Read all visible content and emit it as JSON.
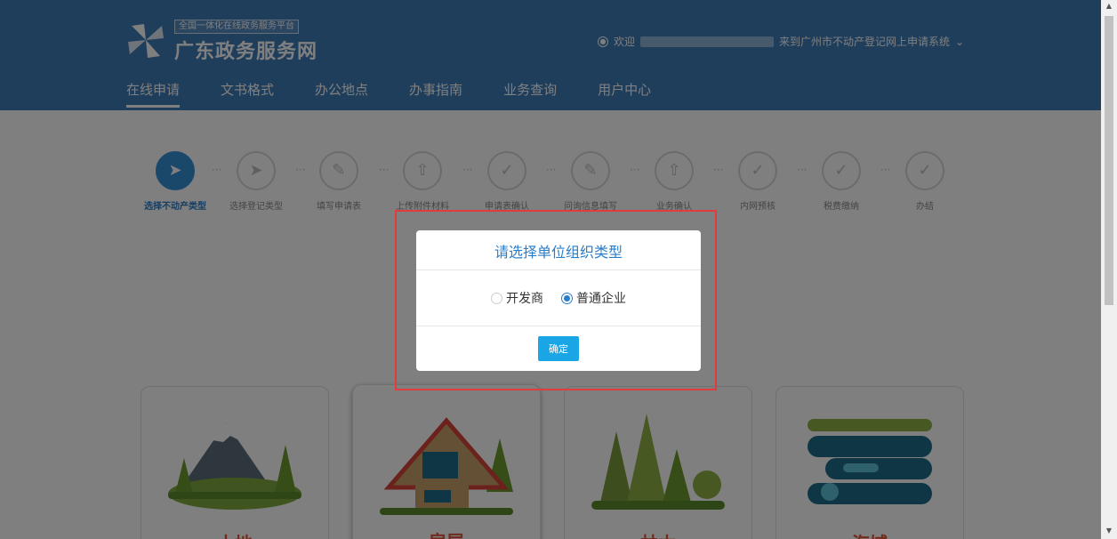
{
  "header": {
    "platform_tag": "全国一体化在线政务服务平台",
    "site_name": "广东政务服务网",
    "welcome_prefix": "欢迎",
    "welcome_suffix": "来到广州市不动产登记网上申请系统",
    "user_icon": "user-icon",
    "dropdown_icon": "chevron-down-icon"
  },
  "nav": [
    "在线申请",
    "文书格式",
    "办公地点",
    "办事指南",
    "业务查询",
    "用户中心"
  ],
  "steps": [
    {
      "label": "选择不动产类型",
      "icon": "cursor-icon",
      "active": true
    },
    {
      "label": "选择登记类型",
      "icon": "cursor-icon"
    },
    {
      "label": "填写申请表",
      "icon": "pencil-icon"
    },
    {
      "label": "上传附件材料",
      "icon": "upload-icon"
    },
    {
      "label": "申请表确认",
      "icon": "edit-check-icon"
    },
    {
      "label": "问询信息填写",
      "icon": "pencil-icon"
    },
    {
      "label": "业务确认",
      "icon": "upload-icon"
    },
    {
      "label": "内网预核",
      "icon": "check-circle-icon"
    },
    {
      "label": "税费缴纳",
      "icon": "check-circle-icon"
    },
    {
      "label": "办结",
      "icon": "edit-check-icon"
    }
  ],
  "cards": [
    {
      "title": "土地"
    },
    {
      "title": "房屋"
    },
    {
      "title": "林木"
    },
    {
      "title": "海域"
    }
  ],
  "modal": {
    "title": "请选择单位组织类型",
    "options": [
      {
        "label": "开发商",
        "checked": false
      },
      {
        "label": "普通企业",
        "checked": true
      }
    ],
    "confirm_label": "确定"
  },
  "colors": {
    "header_bg": "#3f7db9",
    "accent": "#2a7dc9",
    "button": "#19a5e6",
    "highlight": "#e23b3b"
  }
}
